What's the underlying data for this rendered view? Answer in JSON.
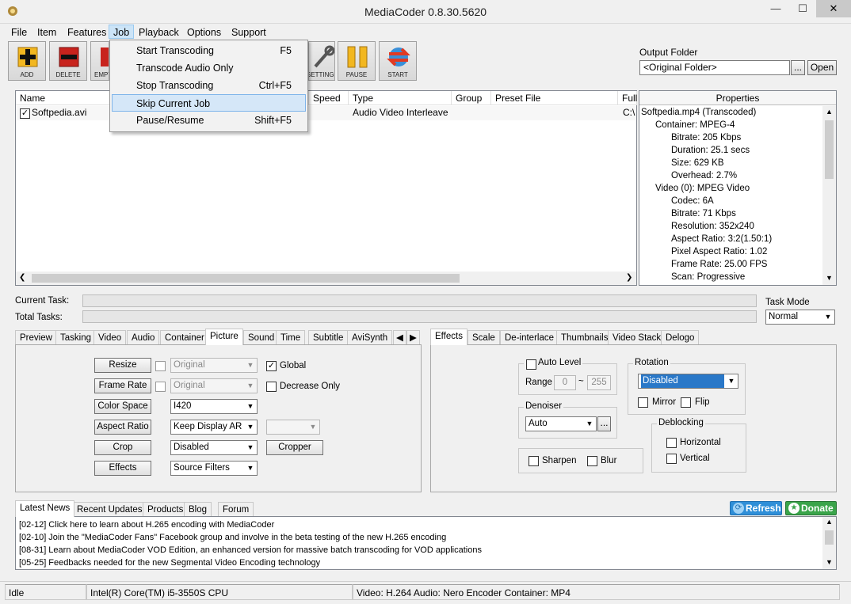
{
  "window": {
    "title": "MediaCoder 0.8.30.5620"
  },
  "menu": [
    "File",
    "Item",
    "Features",
    "Job",
    "Playback",
    "Options",
    "Support"
  ],
  "job_menu": [
    {
      "label": "Start Transcoding",
      "shortcut": "F5"
    },
    {
      "label": "Transcode Audio Only",
      "shortcut": ""
    },
    {
      "label": "Stop Transcoding",
      "shortcut": "Ctrl+F5"
    },
    {
      "label": "Skip Current Job",
      "shortcut": ""
    },
    {
      "label": "Pause/Resume",
      "shortcut": "Shift+F5"
    }
  ],
  "toolbar": [
    "ADD",
    "DELETE",
    "EMPTY",
    "SETTINGS",
    "PAUSE",
    "START"
  ],
  "output": {
    "label": "Output Folder",
    "value": "<Original Folder>",
    "browse": "...",
    "open": "Open"
  },
  "filelist": {
    "columns": [
      "Name",
      "Speed",
      "Type",
      "Group",
      "Preset File",
      "Full"
    ],
    "rows": [
      {
        "name": "Softpedia.avi",
        "type": "Audio Video Interleave",
        "full": "C:\\"
      }
    ]
  },
  "properties": {
    "header": "Properties",
    "lines": [
      "Softpedia.mp4 (Transcoded)",
      "Container: MPEG-4",
      "Bitrate: 205 Kbps",
      "Duration: 25.1 secs",
      "Size: 629 KB",
      "Overhead: 2.7%",
      "Video (0): MPEG Video",
      "Codec: 6A",
      "Bitrate: 71 Kbps",
      "Resolution: 352x240",
      "Aspect Ratio: 3:2(1.50:1)",
      "Pixel Aspect Ratio: 1.02",
      "Frame Rate: 25.00 FPS",
      "Scan: Progressive"
    ]
  },
  "tasks": {
    "current": "Current Task:",
    "total": "Total Tasks:",
    "mode_label": "Task Mode",
    "mode_value": "Normal"
  },
  "left_tabs": [
    "Preview",
    "Tasking",
    "Video",
    "Audio",
    "Container",
    "Picture",
    "Sound",
    "Time",
    "Subtitle",
    "AviSynth"
  ],
  "picture": {
    "resize": "Resize",
    "frame_rate": "Frame Rate",
    "color_space": "Color Space",
    "aspect_ratio": "Aspect Ratio",
    "crop": "Crop",
    "effects": "Effects",
    "resize_val": "Original",
    "frame_val": "Original",
    "color_val": "I420",
    "aspect_val": "Keep Display AR",
    "crop_val": "Disabled",
    "effects_val": "Source Filters",
    "global": "Global",
    "decrease": "Decrease Only",
    "cropper": "Cropper"
  },
  "right_tabs": [
    "Effects",
    "Scale",
    "De-interlace",
    "Thumbnails",
    "Video Stack",
    "Delogo"
  ],
  "effects": {
    "auto_level": "Auto Level",
    "range": "Range",
    "range_min": "0",
    "range_sep": "~",
    "range_max": "255",
    "rotation": "Rotation",
    "rotation_val": "Disabled",
    "mirror": "Mirror",
    "flip": "Flip",
    "denoiser": "Denoiser",
    "denoiser_val": "Auto",
    "denoiser_btn": "...",
    "deblocking": "Deblocking",
    "horizontal": "Horizontal",
    "vertical": "Vertical",
    "sharpen": "Sharpen",
    "blur": "Blur"
  },
  "news_tabs": [
    "Latest News",
    "Recent Updates",
    "Products",
    "Blog",
    "Forum"
  ],
  "news_buttons": {
    "refresh": "Refresh",
    "donate": "Donate"
  },
  "news": [
    "[02-12] Click here to learn about H.265 encoding with MediaCoder",
    "[02-10] Join the \"MediaCoder Fans\" Facebook group and involve in the beta testing of the new H.265 encoding",
    "[08-31] Learn about MediaCoder VOD Edition, an enhanced version for massive batch transcoding for VOD applications",
    "[05-25] Feedbacks needed for the new Segmental Video Encoding technology"
  ],
  "status": {
    "state": "Idle",
    "cpu": "Intel(R) Core(TM) i5-3550S CPU",
    "codec": "Video: H.264  Audio: Nero Encoder  Container: MP4"
  },
  "colors": {
    "accent": "#2a78c8",
    "menu_highlight": "#d5e7f8",
    "refresh": "#2f8fd8",
    "donate": "#3aa44a"
  }
}
